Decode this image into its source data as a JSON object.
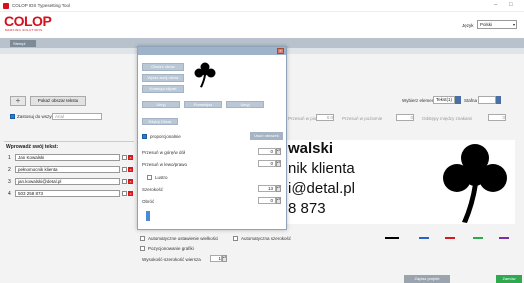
{
  "window": {
    "title": "COLOP IDS Typesetting Tool",
    "minimize": "–",
    "maximize": "□"
  },
  "logo": {
    "brand": "COLOP",
    "tagline": "MARKING SOLUTIONS"
  },
  "language": {
    "label": "Język",
    "value": "Polski"
  },
  "toolbar": {
    "tab": "Stempl"
  },
  "top_panel": {
    "pick_button": "Pokaż obszar tekstu",
    "apply_all_label": "Zastosuj do wszystkich",
    "apply_all_value": "Arial",
    "select_element_label": "Wybierz element",
    "select_element_value": "Tekst(1)",
    "style_label": "Stafna",
    "line_spacing_label": "Przesuń w poziomie",
    "line_spacing_value": "0",
    "spacing_label": "Odstępy między znakami",
    "spacing_value": "0",
    "move_hint": "Przesuń w pionie",
    "move_value": "0.0"
  },
  "text_section": {
    "title": "Wprowadź swój tekst:",
    "rows": [
      {
        "num": "1",
        "value": "Jan Kowalski"
      },
      {
        "num": "2",
        "value": "pełnomocnik klienta"
      },
      {
        "num": "3",
        "value": "jan.kowalski@detal.pl"
      },
      {
        "num": "4",
        "value": "503 258 873"
      }
    ]
  },
  "preview": {
    "lines": [
      "walski",
      "nik klienta",
      "i@detal.pl",
      "8 873"
    ]
  },
  "modal": {
    "buttons": [
      "Otwórz obraz",
      "Wpisz swój obraz",
      "Kolekcja klipart"
    ],
    "small_buttons": [
      "Ukryj",
      "Pomniejsz",
      "Ukryj"
    ],
    "reset_button": "Edytuj Obraz",
    "proportional_label": "proporcjonalnie",
    "delete_button": "Usuń obrazek",
    "fields": [
      {
        "label": "Przesuń w górę/w dół",
        "value": "0"
      },
      {
        "label": "Przesuń w lewo/prawo",
        "value": "0"
      },
      {
        "label": "Szerokość",
        "value": "13"
      },
      {
        "label": "Obróć",
        "value": "0"
      }
    ],
    "mirror_label": "Lustro"
  },
  "bottom_options": {
    "auto_size_label": "Automatyczne ustawienie wielkości",
    "auto_width_label": "Automatyczna szerokość",
    "graphics_label": "Pozycjonowanie grafiki",
    "line_height_label": "Wysokość-szerokość wiersza",
    "line_height_value": "1"
  },
  "footer": {
    "save_button": "Zapisz projekt",
    "next_button": "Zamów"
  },
  "colors": {
    "brand_red": "#d4111e",
    "toolbar": "#b8c2cc",
    "modal_head": "#9eb3ca",
    "green": "#2fa84f"
  }
}
